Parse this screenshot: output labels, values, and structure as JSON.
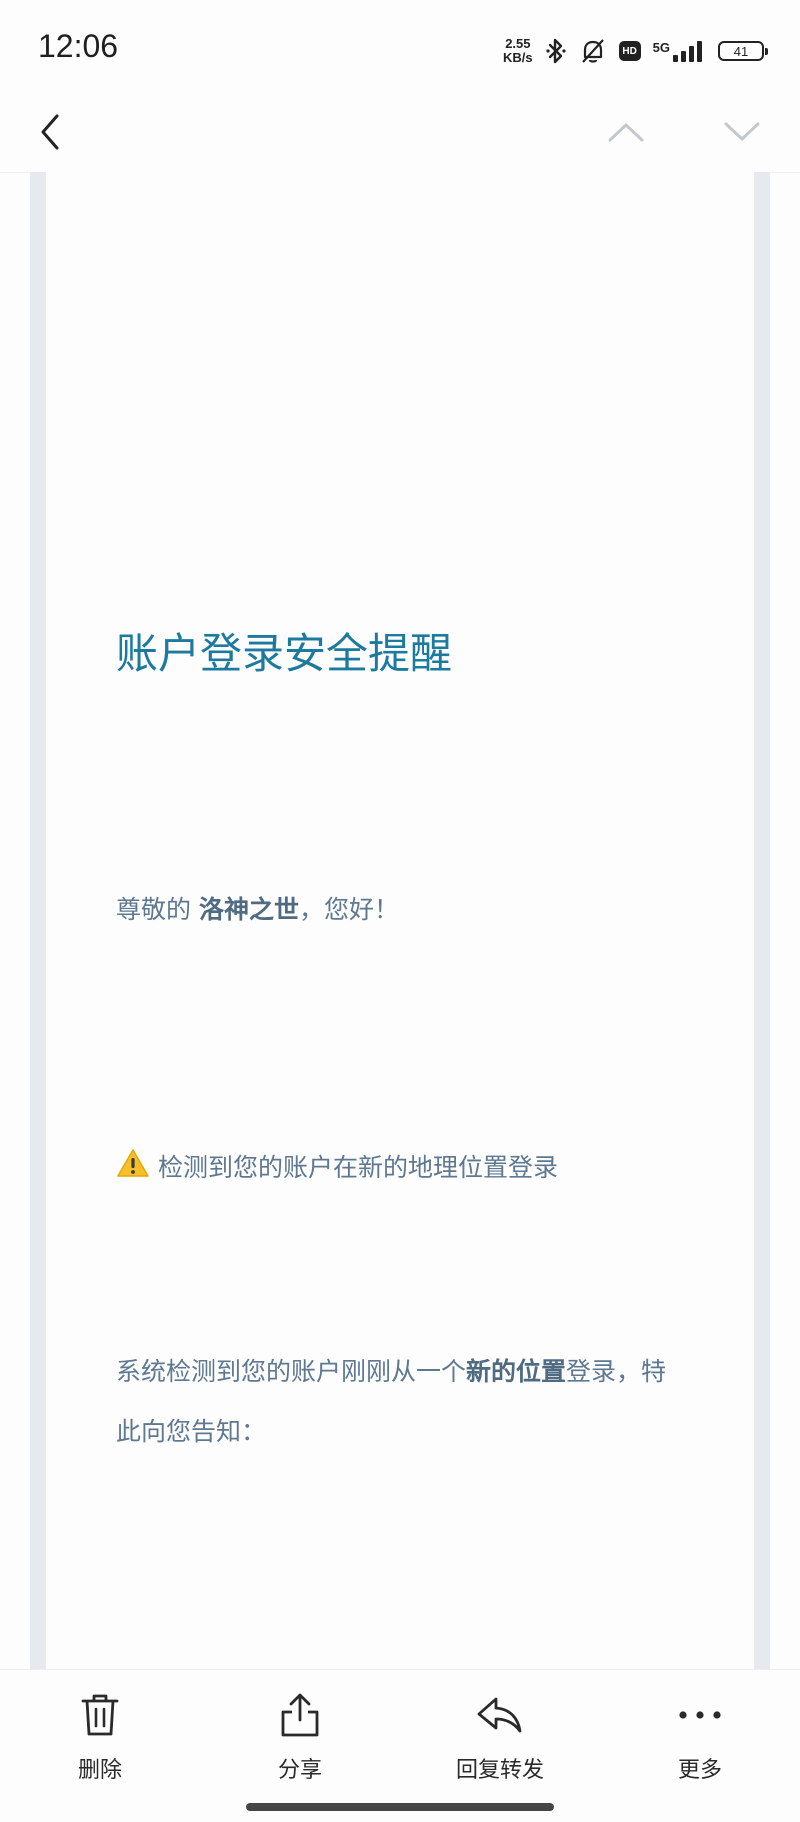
{
  "status_bar": {
    "time": "12:06",
    "net_speed_value": "2.55",
    "net_speed_unit": "KB/s",
    "hd_label": "HD",
    "network_label": "5G",
    "battery": "41"
  },
  "nav": {
    "back_icon": "chevron-left-icon",
    "prev_icon": "chevron-up-icon",
    "next_icon": "chevron-down-icon"
  },
  "mail": {
    "title": "账户登录安全提醒",
    "greeting_prefix": "尊敬的 ",
    "greeting_name": "洛神之世",
    "greeting_suffix": "，您好！",
    "warning_emoji": "⚠️",
    "warning_text": "检测到您的账户在新的地理位置登录",
    "body_prefix": "系统检测到您的账户刚刚从一个",
    "body_bold": "新的位置",
    "body_suffix": "登录，特此向您告知："
  },
  "toolbar": {
    "delete_label": "删除",
    "share_label": "分享",
    "reply_label": "回复转发",
    "more_label": "更多"
  },
  "colors": {
    "title": "#1c7a9e",
    "text": "#5d7890",
    "frame": "#e6eaee"
  }
}
